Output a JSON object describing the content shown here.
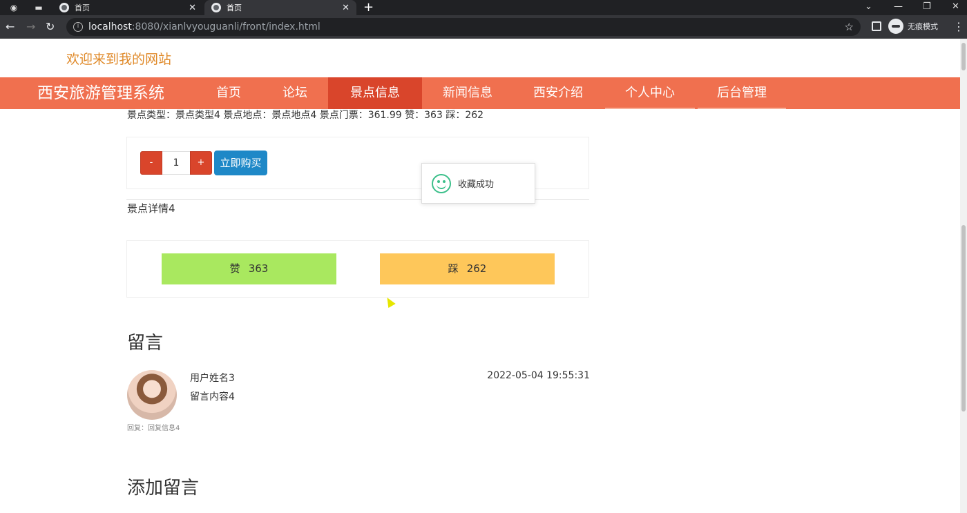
{
  "browser": {
    "tabs": [
      {
        "title": "首页",
        "active": false
      },
      {
        "title": "首页",
        "active": true
      }
    ],
    "url_host": "localhost",
    "url_rest": ":8080/xianlvyouguanli/front/index.html",
    "profile_label": "无痕模式"
  },
  "site": {
    "welcome": "欢迎来到我的网站",
    "brand": "西安旅游管理系统",
    "nav": [
      "首页",
      "论坛",
      "景点信息",
      "新闻信息",
      "西安介绍",
      "个人中心",
      "后台管理"
    ],
    "active_nav": "景点信息"
  },
  "spot": {
    "clipped_info": "景点类型：景点类型4 景点地点：景点地点4 景点门票：361.99 赞：363 踩：262",
    "qty_minus": "-",
    "qty_value": "1",
    "qty_plus": "+",
    "buy_label": "立即购买",
    "detail": "景点详情4",
    "like_label": "赞",
    "like_count": "363",
    "dislike_label": "踩",
    "dislike_count": "262"
  },
  "toast": {
    "message": "收藏成功"
  },
  "comments": {
    "heading": "留言",
    "items": [
      {
        "user": "用户姓名3",
        "content": "留言内容4",
        "time": "2022-05-04 19:55:31",
        "reply": "回复：回复信息4"
      }
    ],
    "add_heading": "添加留言"
  }
}
